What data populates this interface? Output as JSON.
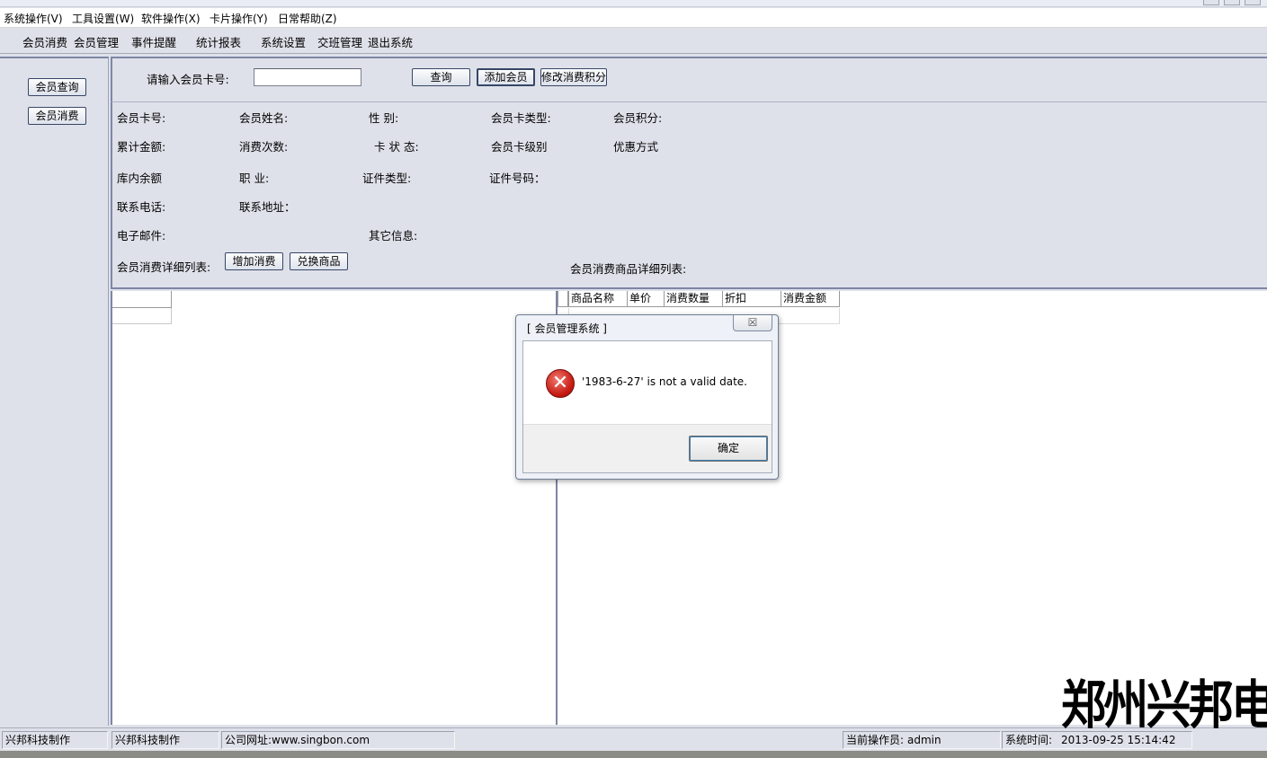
{
  "menu": [
    "系统操作(V)",
    "工具设置(W)",
    "软件操作(X)",
    "卡片操作(Y)",
    "日常帮助(Z)"
  ],
  "toolbar": [
    "会员消费",
    "会员管理",
    "事件提醒",
    "统计报表",
    "系统设置",
    "交班管理",
    "退出系统"
  ],
  "sidebar": {
    "query_button": "会员查询",
    "consume_button": "会员消费"
  },
  "search": {
    "label": "请输入会员卡号:",
    "value": "",
    "query_button": "查询",
    "add_member_button": "添加会员",
    "modify_points_button": "修改消费积分"
  },
  "info": {
    "card_no": "会员卡号:",
    "name": "会员姓名:",
    "gender": "性      别:",
    "card_type": "会员卡类型:",
    "points": "会员积分:",
    "total_amount": "累计金额:",
    "consume_count": "消费次数:",
    "card_status": "卡 状 态:",
    "card_level": "会员卡级别",
    "discount": "优惠方式",
    "balance": "库内余额",
    "job": "职      业:",
    "id_type": "证件类型:",
    "id_no": "证件号码：",
    "phone": "联系电话:",
    "address": "联系地址：",
    "email": "电子邮件:",
    "other": "其它信息:",
    "detail_list": "会员消费详细列表:",
    "add_consume_button": "增加消费",
    "exchange_button": "兑换商品",
    "goods_list": "会员消费商品详细列表:"
  },
  "goods_columns": [
    "商品名称",
    "单价",
    "消费数量",
    "折扣",
    "消费金额"
  ],
  "status": {
    "cell1": "兴邦科技制作",
    "cell2": "兴邦科技制作",
    "website": "公司网址:www.singbon.com",
    "operator_label": "当前操作员:",
    "operator": "admin",
    "time_label": "系统时间:",
    "time": "2013-09-25 15:14:42"
  },
  "watermark": "郑州兴邦电子",
  "dialog": {
    "title": "[ 会员管理系统 ]",
    "close": "☒",
    "message": "'1983-6-27' is not a valid date.",
    "ok_button": "确定"
  }
}
